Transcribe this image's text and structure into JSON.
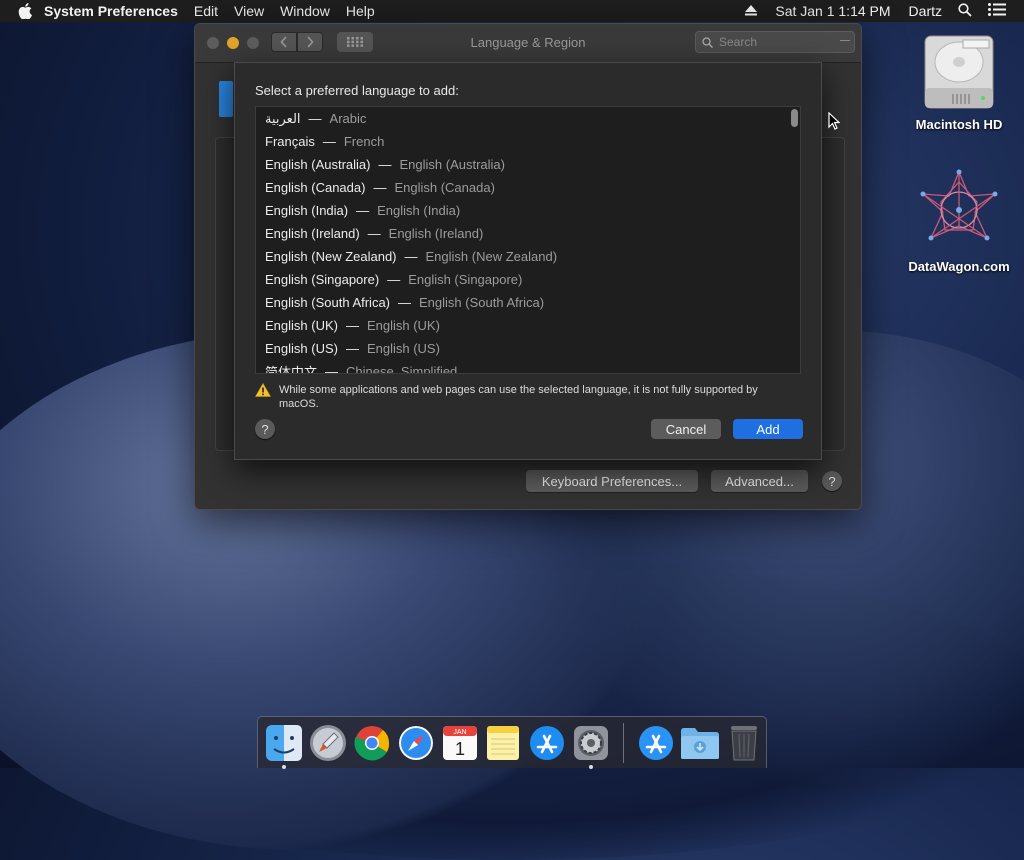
{
  "menubar": {
    "app_name": "System Preferences",
    "menus": [
      "Edit",
      "View",
      "Window",
      "Help"
    ],
    "datetime": "Sat Jan 1  1:14 PM",
    "user": "Dartz"
  },
  "desktop": {
    "icons": [
      {
        "label": "Macintosh HD",
        "icon": "hard-drive-icon"
      },
      {
        "label": "DataWagon.com",
        "icon": "star-network-icon"
      }
    ]
  },
  "window": {
    "title": "Language & Region",
    "search_placeholder": "Search",
    "keyboard_prefs_label": "Keyboard Preferences...",
    "advanced_label": "Advanced...",
    "help_label": "?"
  },
  "sheet": {
    "prompt": "Select a preferred language to add:",
    "languages": [
      {
        "native": "العربية",
        "english": "Arabic"
      },
      {
        "native": "Français",
        "english": "French"
      },
      {
        "native": "English (Australia)",
        "english": "English (Australia)"
      },
      {
        "native": "English (Canada)",
        "english": "English (Canada)"
      },
      {
        "native": "English (India)",
        "english": "English (India)"
      },
      {
        "native": "English (Ireland)",
        "english": "English (Ireland)"
      },
      {
        "native": "English (New Zealand)",
        "english": "English (New Zealand)"
      },
      {
        "native": "English (Singapore)",
        "english": "English (Singapore)"
      },
      {
        "native": "English (South Africa)",
        "english": "English (South Africa)"
      },
      {
        "native": "English (UK)",
        "english": "English (UK)"
      },
      {
        "native": "English (US)",
        "english": "English (US)"
      },
      {
        "native": "简体中文",
        "english": "Chinese, Simplified"
      }
    ],
    "separator": "—",
    "warning": "While some applications and web pages can use the selected language, it is not fully supported by macOS.",
    "help_label": "?",
    "cancel_label": "Cancel",
    "add_label": "Add"
  },
  "dock": {
    "apps": [
      "finder-icon",
      "launchpad-icon",
      "chrome-icon",
      "safari-icon",
      "calendar-icon",
      "notes-icon",
      "app-store-icon",
      "system-preferences-icon"
    ],
    "extras": [
      "app-store-download-icon",
      "downloads-folder-icon",
      "trash-icon"
    ],
    "calendar_month": "JAN",
    "calendar_day": "1"
  },
  "colors": {
    "accent": "#1f6fe0",
    "minimize": "#e1a52a"
  }
}
